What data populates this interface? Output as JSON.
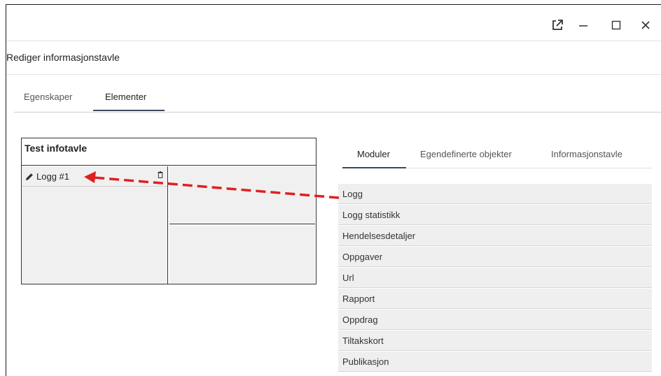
{
  "window": {
    "controls": [
      {
        "name": "popout-icon"
      },
      {
        "name": "minimize-icon"
      },
      {
        "name": "maximize-icon"
      },
      {
        "name": "close-icon"
      }
    ]
  },
  "dialog": {
    "title": "Rediger informasjonstavle",
    "tabs": [
      "Egenskaper",
      "Elementer"
    ],
    "active_tab": "Elementer"
  },
  "board": {
    "title": "Test infotavle",
    "cells": [
      {
        "label": "Logg #1"
      }
    ]
  },
  "panel": {
    "tabs": [
      "Moduler",
      "Egendefinerte objekter",
      "Informasjonstavle"
    ],
    "active_tab": "Moduler",
    "modules": [
      "Logg",
      "Logg statistikk",
      "Hendelsesdetaljer",
      "Oppgaver",
      "Url",
      "Rapport",
      "Oppdrag",
      "Tiltakskort",
      "Publikasjon"
    ]
  },
  "annotation": {
    "arrow_color": "#e02020"
  }
}
